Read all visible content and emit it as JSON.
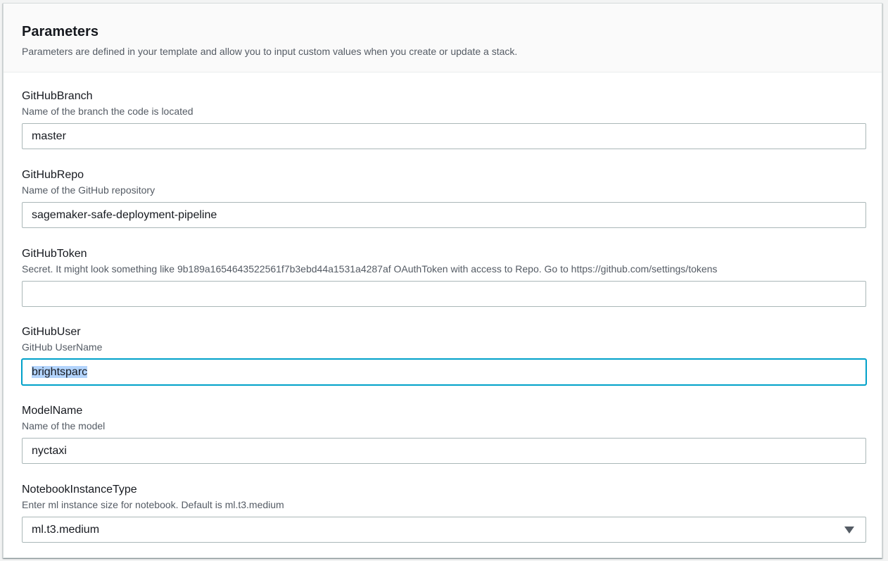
{
  "panel": {
    "title": "Parameters",
    "description": "Parameters are defined in your template and allow you to input custom values when you create or update a stack."
  },
  "params": [
    {
      "label": "GitHubBranch",
      "description": "Name of the branch the code is located",
      "value": "master"
    },
    {
      "label": "GitHubRepo",
      "description": "Name of the GitHub repository",
      "value": "sagemaker-safe-deployment-pipeline"
    },
    {
      "label": "GitHubToken",
      "description": "Secret. It might look something like 9b189a1654643522561f7b3ebd44a1531a4287af OAuthToken with access to Repo. Go to https://github.com/settings/tokens",
      "value": ""
    },
    {
      "label": "GitHubUser",
      "description": "GitHub UserName",
      "value": "brightsparc"
    },
    {
      "label": "ModelName",
      "description": "Name of the model",
      "value": "nyctaxi"
    },
    {
      "label": "NotebookInstanceType",
      "description": "Enter ml instance size for notebook. Default is ml.t3.medium",
      "value": "ml.t3.medium"
    }
  ],
  "colors": {
    "focus_border": "#00a1c9",
    "text_selection": "#b3d4fc"
  }
}
